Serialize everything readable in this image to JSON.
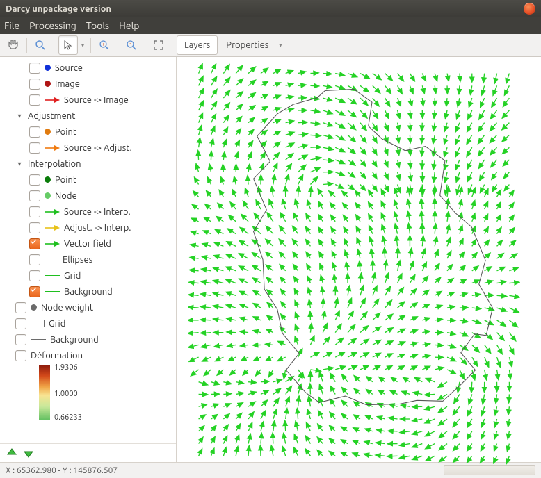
{
  "title": "Darcy unpackage version",
  "menu": {
    "file": "File",
    "processing": "Processing",
    "tools": "Tools",
    "help": "Help"
  },
  "toolbar": {
    "layers": "Layers",
    "properties": "Properties"
  },
  "colors": {
    "vector": "#25d225",
    "blue": "#1030d8",
    "redDot": "#b01515",
    "orangeDot": "#e07b10",
    "darkGreen": "#0a7c0a",
    "lightGreen": "#66cc66",
    "red": "#e02020",
    "orange": "#f07b10",
    "green": "#1fbf1f",
    "yellow": "#e8c21a",
    "gray": "#6b6b6b"
  },
  "tree": {
    "top": [
      {
        "label": "Source",
        "type": "dot",
        "color": "blue",
        "checked": false
      },
      {
        "label": "Image",
        "type": "dot",
        "color": "redDot",
        "checked": false
      },
      {
        "label": "Source -> Image",
        "type": "arrow",
        "color": "red",
        "checked": false
      }
    ],
    "adjustment": {
      "label": "Adjustment",
      "items": [
        {
          "label": "Point",
          "type": "dot",
          "color": "orangeDot",
          "checked": false
        },
        {
          "label": "Source -> Adjust.",
          "type": "arrow",
          "color": "orange",
          "checked": false
        }
      ]
    },
    "interpolation": {
      "label": "Interpolation",
      "items": [
        {
          "label": "Point",
          "type": "dot",
          "color": "darkGreen",
          "checked": false
        },
        {
          "label": "Node",
          "type": "dot",
          "color": "lightGreen",
          "checked": false
        },
        {
          "label": "Source -> Interp.",
          "type": "arrow",
          "color": "green",
          "checked": false
        },
        {
          "label": "Adjust. -> Interp.",
          "type": "arrow",
          "color": "yellow",
          "checked": false
        },
        {
          "label": "Vector field",
          "type": "arrow",
          "color": "green",
          "checked": true
        },
        {
          "label": "Ellipses",
          "type": "rect",
          "color": "green",
          "checked": false
        },
        {
          "label": "Grid",
          "type": "line",
          "color": "green",
          "checked": false
        },
        {
          "label": "Background",
          "type": "line",
          "color": "green",
          "checked": true
        }
      ]
    },
    "bottom": [
      {
        "label": "Node weight",
        "type": "dot",
        "color": "gray",
        "checked": false,
        "indent": 1
      },
      {
        "label": "Grid",
        "type": "rect",
        "color": "gray",
        "checked": false,
        "indent": 1
      },
      {
        "label": "Background",
        "type": "line",
        "color": "gray",
        "checked": false,
        "indent": 1
      },
      {
        "label": "Déformation",
        "type": "none",
        "checked": false,
        "indent": 1
      }
    ]
  },
  "gradient": {
    "max": "1.9306",
    "mid": "1.0000",
    "min": "0.66233"
  },
  "status": "X : 65362.980 - Y : 145876.507"
}
